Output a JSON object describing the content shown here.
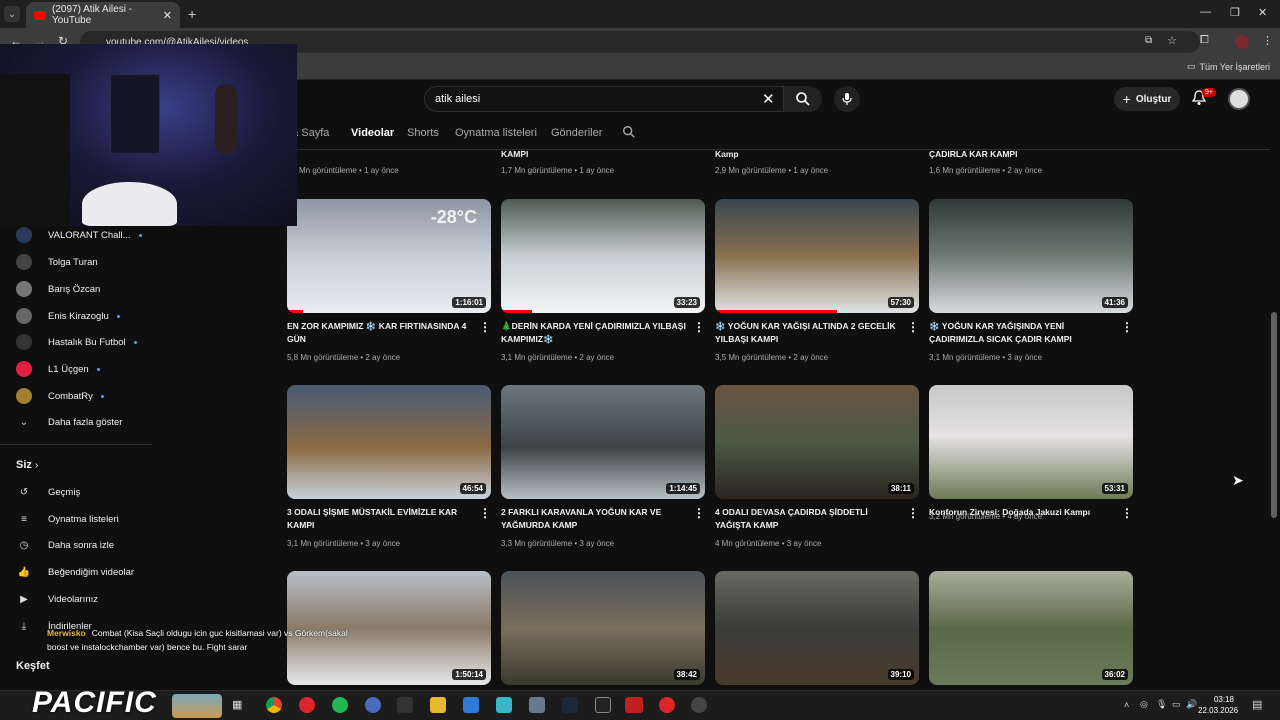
{
  "browser": {
    "tab_title": "(2097) Atik Ailesi - YouTube",
    "url": "youtube.com/@AtikAilesi/videos",
    "bookmarks_label": "Tüm Yer İşaretleri"
  },
  "header": {
    "search_value": "atik ailesi",
    "create_label": "Oluştur",
    "notif_badge": "9+"
  },
  "channel_tabs": [
    "na Sayfa",
    "Videolar",
    "Shorts",
    "Oynatma listeleri",
    "Gönderiler"
  ],
  "sidebar": {
    "subscriptions": [
      {
        "label": "VALORANT Chall...",
        "dot": true,
        "color": "#2a3a5a"
      },
      {
        "label": "Tolga Turan",
        "dot": false,
        "color": "#444"
      },
      {
        "label": "Barış Özcan",
        "dot": false,
        "color": "#777"
      },
      {
        "label": "Enis Kirazoglu",
        "dot": true,
        "color": "#666"
      },
      {
        "label": "Hastalık Bu Futbol",
        "dot": true,
        "color": "#333"
      },
      {
        "label": "L1 Üçgen",
        "dot": true,
        "color": "#e02040"
      },
      {
        "label": "CombatRy",
        "dot": true,
        "color": "#a08030"
      }
    ],
    "show_more": "Daha fazla göster",
    "you_heading": "Siz",
    "you_items": [
      "Geçmiş",
      "Oynatma listeleri",
      "Daha sonra izle",
      "Beğendiğim videolar",
      "Videolarınız",
      "İndirilenler"
    ],
    "explore_heading": "Keşfet"
  },
  "chat": {
    "user": "Merwisko",
    "message": "Combat (Kisa Saçli oldugu icin guc kisitlamasi var) vs Görkem(sakal boost ve instalockchamber var) bence bu. Fight sarar"
  },
  "overlay_logo": "PACIFIC",
  "top_row": [
    {
      "title": "",
      "meta": "Mn görüntüleme • 1 ay önce"
    },
    {
      "title": "KAMPI",
      "meta": "1,7 Mn görüntüleme • 1 ay önce"
    },
    {
      "title": "Kamp",
      "meta": "2,9 Mn görüntüleme • 1 ay önce"
    },
    {
      "title": "ÇADIRLA KAR KAMPI",
      "meta": "1,6 Mn görüntüleme • 2 ay önce"
    }
  ],
  "videos": [
    {
      "title": "EN ZOR KAMPIMIZ ❄️ KAR FIRTINASINDA 4 GÜN",
      "meta": "5,8 Mn görüntüleme • 2 ay önce",
      "duration": "1:16:01",
      "progress": 0.08,
      "bg": "linear-gradient(180deg,#8d96a3 0%,#c9ced6 50%,#e9ecf0 100%)",
      "overlay": "-28°C"
    },
    {
      "title": "🎄DERİN KARDA YENİ ÇADIRIMIZLA YILBAŞI KAMPIMIZ❄️",
      "meta": "3,1 Mn görüntüleme • 2 ay önce",
      "duration": "33:23",
      "progress": 0.15,
      "bg": "linear-gradient(180deg,#4d5a52 0%,#c8cfd2 50%,#f2f4f6 100%)",
      "overlay": ""
    },
    {
      "title": "❄️ YOĞUN KAR YAĞIŞI ALTINDA 2 GECELİK YILBAŞI KAMPI",
      "meta": "3,5 Mn görüntüleme • 2 ay önce",
      "duration": "57:30",
      "progress": 0.6,
      "bg": "linear-gradient(180deg,#3a4650 0%,#8a7050 50%,#dfe3e7 100%)",
      "overlay": ""
    },
    {
      "title": "❄️ YOĞUN KAR YAĞIŞINDA YENİ ÇADIRIMIZLA SICAK ÇADIR KAMPI",
      "meta": "3,1 Mn görüntüleme • 3 ay önce",
      "duration": "41:36",
      "progress": 0,
      "bg": "linear-gradient(180deg,#2f3a38 0%,#6d7a74 50%,#d7dcdf 100%)",
      "overlay": ""
    },
    {
      "title": "3 ODALI ŞİŞME MÜSTAKİL EVİMİZLE KAR KAMPI",
      "meta": "3,1 Mn görüntüleme • 3 ay önce",
      "duration": "46:54",
      "progress": 0,
      "bg": "linear-gradient(180deg,#4a5a72 0%,#8a6a44 55%,#c9d2dc 100%)",
      "overlay": ""
    },
    {
      "title": "2 FARKLI KARAVANLA YOĞUN KAR VE YAĞMURDA KAMP",
      "meta": "3,3 Mn görüntüleme • 3 ay önce",
      "duration": "1:14:45",
      "progress": 0,
      "bg": "linear-gradient(180deg,#6d767d 0%,#3c4446 55%,#b9c0c4 100%)",
      "overlay": ""
    },
    {
      "title": "4 ODALI DEVASA ÇADIRDA ŞİDDETLİ YAĞIŞTA KAMP",
      "meta": "4 Mn görüntüleme • 3 ay önce",
      "duration": "38:11",
      "progress": 0,
      "bg": "linear-gradient(180deg,#6a5440 0%,#4c5a44 50%,#2a2420 100%)",
      "overlay": ""
    },
    {
      "title": "Konforun Zirvesi: Doğada Jakuzi Kampı",
      "meta": "3,2 Mn görüntüleme • 4 ay önce",
      "duration": "53:31",
      "progress": 0,
      "bg": "linear-gradient(180deg,#c6c8c7 0%,#e5e2e4 45%,#6d7a54 100%)",
      "overlay": ""
    },
    {
      "title": "",
      "meta": "",
      "duration": "1:50:14",
      "progress": 0,
      "bg": "linear-gradient(180deg,#b8c0c8 0%,#8a7a68 50%,#e6e9ec 100%)",
      "overlay": ""
    },
    {
      "title": "",
      "meta": "",
      "duration": "38:42",
      "progress": 0,
      "bg": "linear-gradient(180deg,#4a5258 0%,#7a6e5a 50%,#3a3a30 100%)",
      "overlay": ""
    },
    {
      "title": "",
      "meta": "",
      "duration": "39:10",
      "progress": 0,
      "bg": "linear-gradient(180deg,#6a6a62 0%,#3a3c3a 50%,#4a3a2a 100%)",
      "overlay": ""
    },
    {
      "title": "",
      "meta": "",
      "duration": "36:02",
      "progress": 0,
      "bg": "linear-gradient(180deg,#a8ad9a 0%,#5a6a48 50%,#6a7a5a 100%)",
      "overlay": ""
    }
  ],
  "clock": {
    "time": "03:18",
    "date": "22.03.2026"
  },
  "icons": {
    "back": "←",
    "forward": "→",
    "reload": "↻",
    "close": "✕",
    "plus": "+",
    "search": "⌕",
    "mic": "🎙",
    "bell": "🔔",
    "more": "⋮"
  }
}
